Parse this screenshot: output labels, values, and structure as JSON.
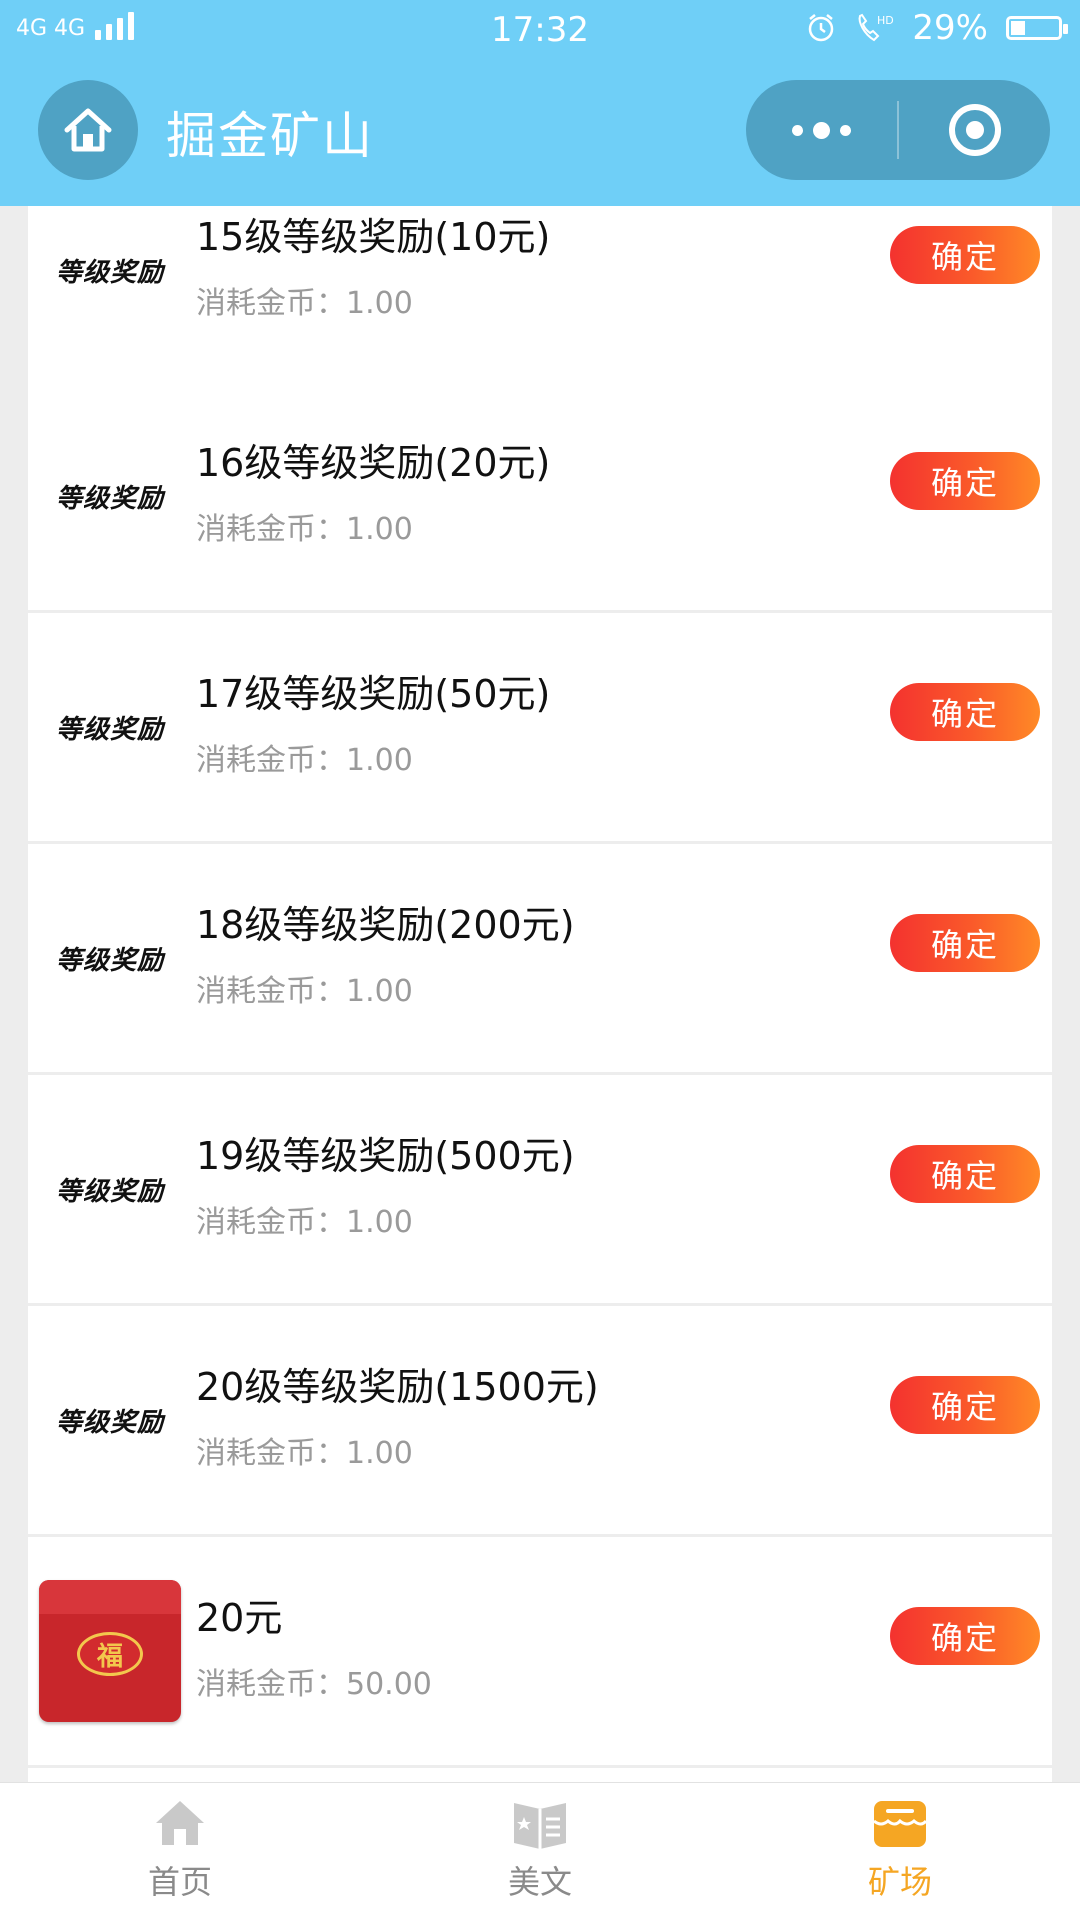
{
  "status_bar": {
    "network": "4G 4G",
    "time": "17:32",
    "battery_percent": "29%",
    "icons": [
      "alarm-icon",
      "hd-call-icon",
      "battery-icon"
    ]
  },
  "header": {
    "title": "掘金矿山",
    "home_icon": "home-icon",
    "menu_icon": "more-dots-icon",
    "close_icon": "target-icon",
    "bg_color": "#6fcff7"
  },
  "rewards": [
    {
      "name": "15级等级奖励(10元)",
      "cost_label": "消耗金币：",
      "cost": "1.00",
      "image_text": "等级奖励",
      "button": "确定"
    },
    {
      "name": "16级等级奖励(20元)",
      "cost_label": "消耗金币：",
      "cost": "1.00",
      "image_text": "等级奖励",
      "button": "确定"
    },
    {
      "name": "17级等级奖励(50元)",
      "cost_label": "消耗金币：",
      "cost": "1.00",
      "image_text": "等级奖励",
      "button": "确定"
    },
    {
      "name": "18级等级奖励(200元)",
      "cost_label": "消耗金币：",
      "cost": "1.00",
      "image_text": "等级奖励",
      "button": "确定"
    },
    {
      "name": "19级等级奖励(500元)",
      "cost_label": "消耗金币：",
      "cost": "1.00",
      "image_text": "等级奖励",
      "button": "确定"
    },
    {
      "name": "20级等级奖励(1500元)",
      "cost_label": "消耗金币：",
      "cost": "1.00",
      "image_text": "等级奖励",
      "button": "确定"
    },
    {
      "name": "20元",
      "cost_label": "消耗金币：",
      "cost": "50.00",
      "image_text": "福",
      "button": "确定"
    }
  ],
  "tabbar": {
    "tabs": [
      {
        "label": "首页",
        "icon": "home-icon",
        "active": false
      },
      {
        "label": "美文",
        "icon": "article-icon",
        "active": false
      },
      {
        "label": "矿场",
        "icon": "shop-icon",
        "active": true
      }
    ],
    "active_color": "#f5a623",
    "inactive_color": "#8a8a8a"
  },
  "button_gradient": [
    "#f4322f",
    "#ff8a26"
  ]
}
